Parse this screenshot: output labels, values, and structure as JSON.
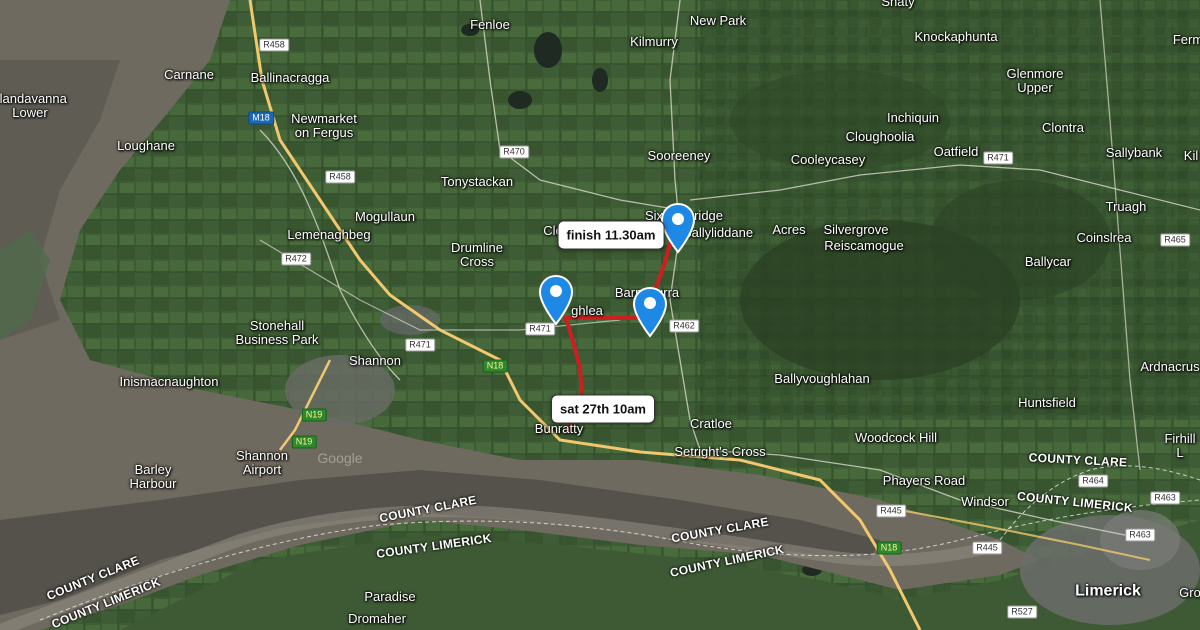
{
  "places": [
    {
      "id": "shaty",
      "text": "Shaty"
    },
    {
      "id": "fenloe",
      "text": "Fenloe"
    },
    {
      "id": "new-park",
      "text": "New Park"
    },
    {
      "id": "kilmurry",
      "text": "Kilmurry"
    },
    {
      "id": "knockaphunta",
      "text": "Knockaphunta"
    },
    {
      "id": "ferm",
      "text": "Ferm"
    },
    {
      "id": "carnane",
      "text": "Carnane"
    },
    {
      "id": "ballinacragga",
      "text": "Ballinacragga"
    },
    {
      "id": "islandavanna-lower",
      "text": "slandavanna\nLower"
    },
    {
      "id": "glenmore-upper",
      "text": "Glenmore\nUpper"
    },
    {
      "id": "newmarket-on-fergus",
      "text": "Newmarket\non Fergus"
    },
    {
      "id": "inchiquin",
      "text": "Inchiquin"
    },
    {
      "id": "clontra",
      "text": "Clontra"
    },
    {
      "id": "loughane",
      "text": "Loughane"
    },
    {
      "id": "cloughoolia",
      "text": "Cloughoolia"
    },
    {
      "id": "sooreeney",
      "text": "Sooreeney"
    },
    {
      "id": "cooleycasey",
      "text": "Cooleycasey"
    },
    {
      "id": "oatfield",
      "text": "Oatfield"
    },
    {
      "id": "sallybank",
      "text": "Sallybank"
    },
    {
      "id": "kil",
      "text": "Kil"
    },
    {
      "id": "tonystackan",
      "text": "Tonystackan"
    },
    {
      "id": "truagh",
      "text": "Truagh"
    },
    {
      "id": "mogullaun",
      "text": "Mogullaun"
    },
    {
      "id": "sixmilebridge",
      "text": "Sixmilebridge"
    },
    {
      "id": "ballyliddane",
      "text": "Ballyliddane"
    },
    {
      "id": "acres",
      "text": "Acres"
    },
    {
      "id": "silvergrove",
      "text": "Silvergrove"
    },
    {
      "id": "reiscamogue",
      "text": "Reiscamogue"
    },
    {
      "id": "coinslrea",
      "text": "Coinslrea"
    },
    {
      "id": "lemenaghbeg",
      "text": "Lemenaghbeg"
    },
    {
      "id": "drumline-cross",
      "text": "Drumline\nCross"
    },
    {
      "id": "clo",
      "text": "Clo"
    },
    {
      "id": "ballycar",
      "text": "Ballycar"
    },
    {
      "id": "barnacurra",
      "text": "Barnacurra"
    },
    {
      "id": "ghlea",
      "text": "ghlea"
    },
    {
      "id": "stonehall",
      "text": "Stonehall\nBusiness Park"
    },
    {
      "id": "shannon",
      "text": "Shannon"
    },
    {
      "id": "ardnacrusha",
      "text": "Ardnacrus"
    },
    {
      "id": "ballyvoughlahan",
      "text": "Ballyvoughlahan"
    },
    {
      "id": "inismacnaughton",
      "text": "Inismacnaughton"
    },
    {
      "id": "huntsfield",
      "text": "Huntsfield"
    },
    {
      "id": "cratloe",
      "text": "Cratloe"
    },
    {
      "id": "bunratty",
      "text": "Bunratty"
    },
    {
      "id": "woodcock-hill",
      "text": "Woodcock Hill"
    },
    {
      "id": "firhill",
      "text": "Firhill\nL"
    },
    {
      "id": "setrights-cross",
      "text": "Setright's Cross"
    },
    {
      "id": "shannon-airport",
      "text": "Shannon\nAirport"
    },
    {
      "id": "barley-harbour",
      "text": "Barley\nHarbour"
    },
    {
      "id": "phayers-road",
      "text": "Phayers Road"
    },
    {
      "id": "windsor",
      "text": "Windsor"
    },
    {
      "id": "limerick",
      "text": "Limerick"
    },
    {
      "id": "gro",
      "text": "Gro"
    },
    {
      "id": "paradise",
      "text": "Paradise"
    },
    {
      "id": "dromaher",
      "text": "Dromaher"
    }
  ],
  "counties": [
    {
      "id": "cc1",
      "text": "COUNTY CLARE"
    },
    {
      "id": "cl1",
      "text": "COUNTY LIMERICK"
    },
    {
      "id": "cc2",
      "text": "COUNTY CLARE"
    },
    {
      "id": "cl2",
      "text": "COUNTY LIMERICK"
    },
    {
      "id": "cc3",
      "text": "COUNTY CLARE"
    },
    {
      "id": "cl3",
      "text": "COUNTY LIMERICK"
    },
    {
      "id": "cc4",
      "text": "COUNTY CLARE"
    },
    {
      "id": "cl4",
      "text": "COUNTY LIMERICK"
    }
  ],
  "road_shields": [
    {
      "id": "r458a",
      "text": "R458",
      "kind": "regional"
    },
    {
      "id": "m18",
      "text": "M18",
      "kind": "motorway"
    },
    {
      "id": "r470",
      "text": "R470",
      "kind": "regional"
    },
    {
      "id": "r458b",
      "text": "R458",
      "kind": "regional"
    },
    {
      "id": "r471a",
      "text": "R471",
      "kind": "regional"
    },
    {
      "id": "r472",
      "text": "R472",
      "kind": "regional"
    },
    {
      "id": "r471b",
      "text": "R471",
      "kind": "regional"
    },
    {
      "id": "r471c",
      "text": "R471",
      "kind": "regional"
    },
    {
      "id": "r462",
      "text": "R462",
      "kind": "regional"
    },
    {
      "id": "n18a",
      "text": "N18",
      "kind": "national"
    },
    {
      "id": "n19a",
      "text": "N19",
      "kind": "national"
    },
    {
      "id": "n19b",
      "text": "N19",
      "kind": "national"
    },
    {
      "id": "r465",
      "text": "R465",
      "kind": "regional"
    },
    {
      "id": "r464",
      "text": "R464",
      "kind": "regional"
    },
    {
      "id": "r463a",
      "text": "R463",
      "kind": "regional"
    },
    {
      "id": "r463b",
      "text": "R463",
      "kind": "regional"
    },
    {
      "id": "r445a",
      "text": "R445",
      "kind": "regional"
    },
    {
      "id": "r445b",
      "text": "R445",
      "kind": "regional"
    },
    {
      "id": "n18b",
      "text": "N18",
      "kind": "national"
    },
    {
      "id": "r527",
      "text": "R527",
      "kind": "regional"
    }
  ],
  "route": {
    "color": "#cc1f1f",
    "start_label": "sat 27th 10am",
    "finish_label": "finish 11.30am"
  },
  "markers": [
    {
      "id": "marker-finish",
      "icon": "map-pin-icon",
      "color": "#1e88e5"
    },
    {
      "id": "marker-west",
      "icon": "map-pin-icon",
      "color": "#1e88e5"
    },
    {
      "id": "marker-east",
      "icon": "map-pin-icon",
      "color": "#1e88e5"
    }
  ],
  "watermark": "Google"
}
